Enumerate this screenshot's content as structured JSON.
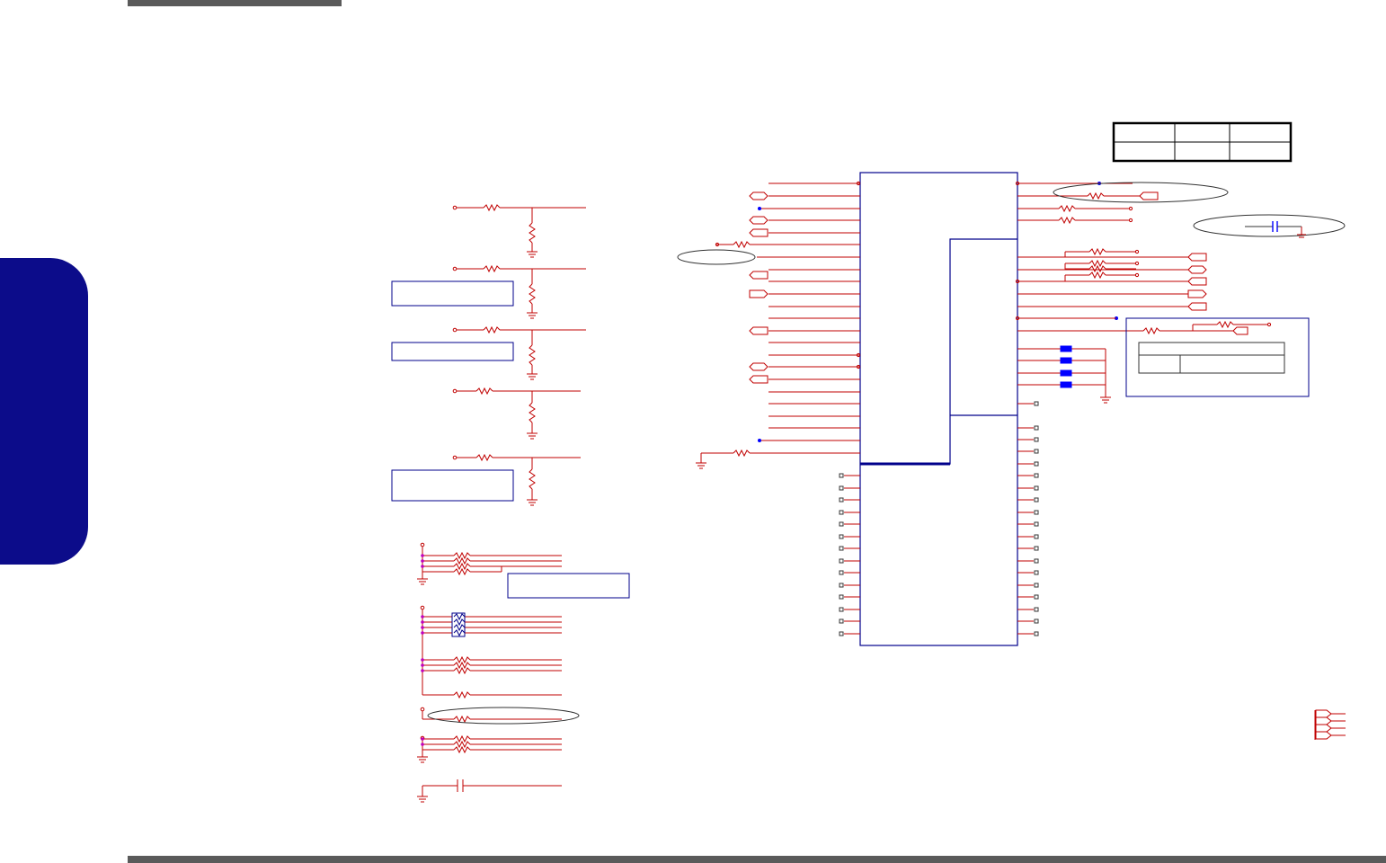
{
  "page": {
    "colors": {
      "wire": "#c00000",
      "outline": "#00008b",
      "marker": "#0000ff",
      "pin": "#333333",
      "bar": "#5a5a5a",
      "tab": "#0c0c8a"
    },
    "icons": [
      "resistor-icon",
      "ground-icon",
      "capacitor-icon",
      "port-connector-icon",
      "jumper-icon"
    ]
  }
}
